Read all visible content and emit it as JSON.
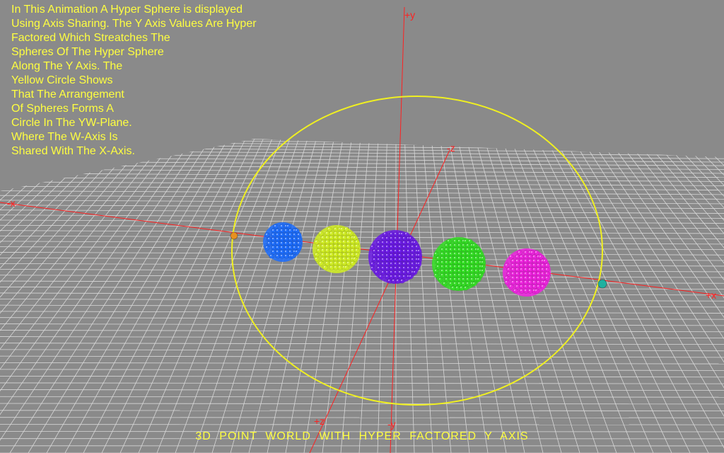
{
  "description_lines": [
    "In This Animation A Hyper Sphere is displayed",
    "Using Axis Sharing. The Y Axis Values Are Hyper",
    "Factored Which Streatches The",
    "Spheres Of The Hyper Sphere",
    "Along The Y Axis. The",
    "Yellow Circle Shows",
    "That The Arrangement",
    "Of Spheres Forms A",
    "Circle In The YW-Plane.",
    "Where The W-Axis Is",
    "Shared With The X-Axis."
  ],
  "caption": "3D POINT WORLD WITH HYPER FACTORED Y AXIS",
  "axes": {
    "pos_y": "+y",
    "neg_y": "-y",
    "pos_x": "+x",
    "neg_x": "-x",
    "pos_z": "+z",
    "neg_z": "-z"
  },
  "colors": {
    "background": "#8a8a8a",
    "grid": "#d8d8d8",
    "axis": "#ff2020",
    "circle": "#f0f020",
    "text": "#ffff40"
  },
  "spheres": [
    {
      "name": "blue-sphere",
      "color": "#1a6cff"
    },
    {
      "name": "yellow-green-sphere",
      "color": "#d2f020"
    },
    {
      "name": "violet-sphere",
      "color": "#6a18e8"
    },
    {
      "name": "green-sphere",
      "color": "#30e020"
    },
    {
      "name": "magenta-sphere",
      "color": "#f020e0"
    }
  ],
  "markers": [
    {
      "name": "orange-marker",
      "color": "#e89020"
    },
    {
      "name": "teal-marker",
      "color": "#20b0a0"
    }
  ]
}
